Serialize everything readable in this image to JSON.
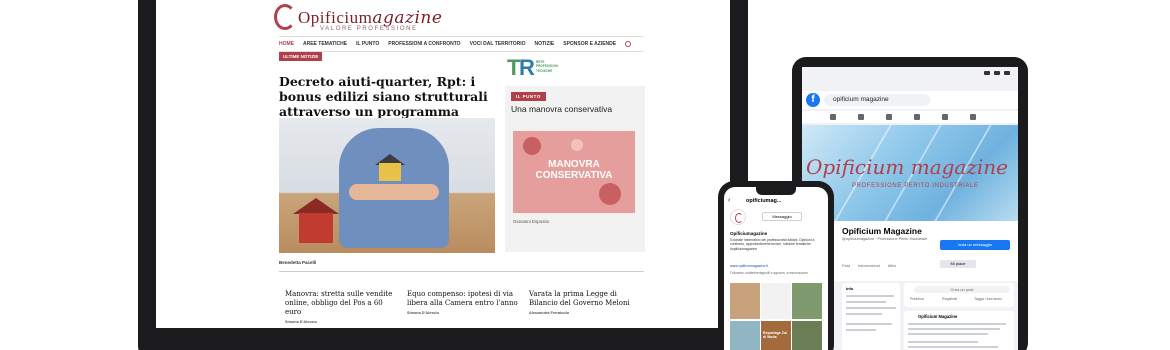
{
  "laptop": {
    "logo_main": "Opificium",
    "logo_italic": "agazine",
    "tagline": "VALORE PROFESSIONE",
    "nav": [
      "HOME",
      "AREE TEMATICHE",
      "IL PUNTO",
      "PROFESSIONI A CONFRONTO",
      "VOCI DAL TERRITORIO",
      "NOTIZIE",
      "SPONSOR E AZIENDE"
    ],
    "section_badge": "ULTIME NOTIZIE",
    "headline": "Decreto aiuti-quarter, Rpt: i bonus edilizi siano strutturali attraverso un programma pluriennale",
    "headline_author": "Benedetta Pacelli",
    "rpt_logo_small": "RETE PROFESSIONI TECNICHE",
    "il_punto_badge": "IL PUNTO",
    "il_punto_title": "Una manovra conservativa",
    "manovra_image_text": "MANOVRA CONSERVATIVA",
    "il_punto_author": "Giovanni Esposito",
    "cards": [
      {
        "title": "Manovra: stretta sulle vendite online, obbligo del Pos a 60 euro",
        "author": "Simona D'Alessio"
      },
      {
        "title": "Equo compenso: ipotesi di via libera alla Camera entro l'anno",
        "author": "Simona D'Alessio"
      },
      {
        "title": "Varata la prima Legge di Bilancio del Governo Meloni",
        "author": "Alessandra Ferraiuolo"
      }
    ]
  },
  "tablet": {
    "search_text": "opificium magazine",
    "cover_title": "Opificium magazine",
    "cover_subtitle": "PROFESSIONE PERITO INDUSTRIALE",
    "page_name": "Opificium Magazine",
    "page_handle": "@opificiumagazine · Professione Perito Industriale",
    "message_button": "Invia un messaggio",
    "like_button": "Mi piace",
    "tabs": [
      "Post",
      "Informazioni",
      "Altro"
    ],
    "composer_placeholder": "Crea un post",
    "composer_actions": [
      "Pubblica",
      "Registrati",
      "Tagga i tuoi amici"
    ],
    "feed_author": "Opificium Magazine",
    "sidebar_heading": "Info"
  },
  "phone": {
    "title": "opificiumag...",
    "message_button": "Messaggio",
    "page_name": "Opificiumagazine",
    "description": "Il portale informativo dei professionisti italiani. Opinioni a confronto, approfondimenti tecnici, rubriche tematiche. #opificiumagazine",
    "link": "www.opificiumagazine.it",
    "followers": "Followers: matteobertagnolli e agricom_comunicazione",
    "tile_text": "Reportage Zoi di Moda"
  },
  "colors": {
    "brand": "#b0404a",
    "facebook_blue": "#1877f2"
  }
}
